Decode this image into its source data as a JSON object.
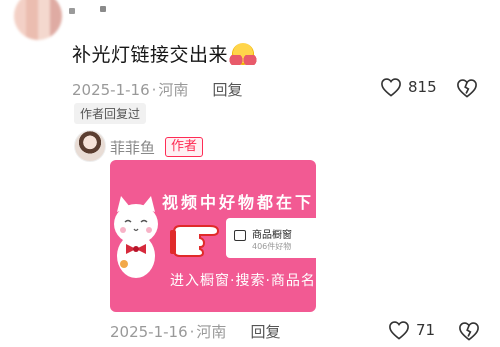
{
  "comment": {
    "text": "补光灯链接交出来",
    "emoji": "hug-emoji",
    "date": "2025-1-16",
    "sep": "·",
    "location": "河南",
    "reply_label": "回复",
    "like_count": "815",
    "author_replied_badge": "作者回复过"
  },
  "reply": {
    "author_name": "菲菲鱼",
    "author_tag": "作者",
    "card": {
      "headline": "视频中好物都在下",
      "window_title": "商品橱窗",
      "window_sub": "406件好物",
      "bottom_text": "进入橱窗·搜索·商品名",
      "bg_color": "#f25a93"
    },
    "date": "2025-1-16",
    "sep": "·",
    "location": "河南",
    "reply_label": "回复",
    "like_count": "71"
  },
  "colors": {
    "accent": "#fe2c55",
    "meta": "#999999"
  }
}
